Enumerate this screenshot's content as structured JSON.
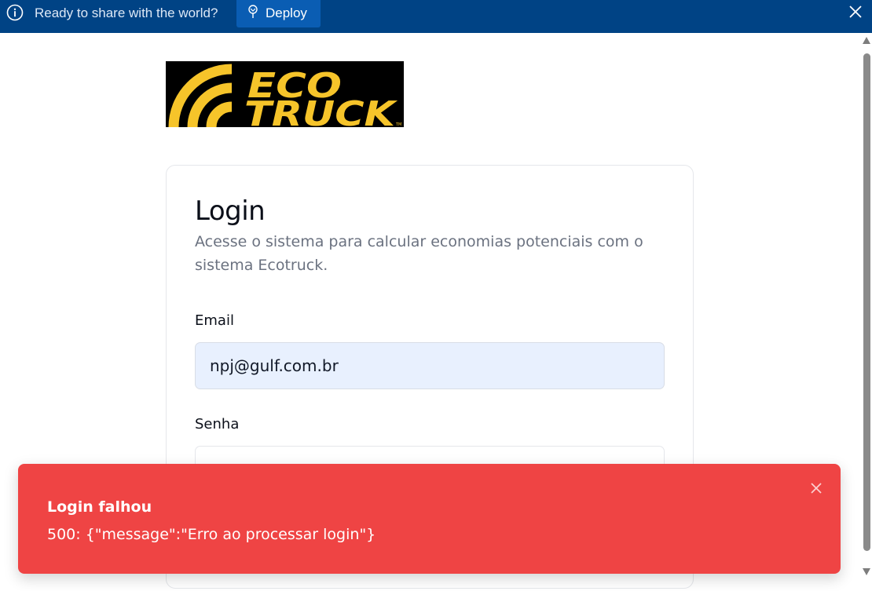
{
  "banner": {
    "message": "Ready to share with the world?",
    "deploy_label": "Deploy",
    "icons": [
      "info-icon",
      "pin-icon",
      "close-icon"
    ]
  },
  "logo": {
    "line1": "ECO",
    "line2": "TRUCK",
    "mark": "TM"
  },
  "login": {
    "title": "Login",
    "subtitle": "Acesse o sistema para calcular economias potenciais com o sistema Ecotruck.",
    "email_label": "Email",
    "email_value": "npj@gulf.com.br",
    "password_label": "Senha",
    "password_value": ""
  },
  "toast": {
    "title": "Login falhou",
    "message": "500: {\"message\":\"Erro ao processar login\"}"
  },
  "colors": {
    "banner_bg": "#004385",
    "deploy_bg": "#0a5db3",
    "toast_bg": "#ef4444",
    "logo_yellow": "#f6c42a",
    "email_bg": "#e8f0fe"
  }
}
